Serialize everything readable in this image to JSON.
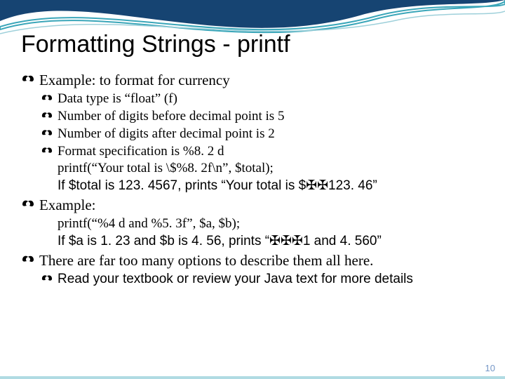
{
  "title": "Formatting Strings - printf",
  "lines": {
    "l1": "Example: to format for currency",
    "l2": "Data type is “float” (f)",
    "l3": "Number of digits before decimal point is 5",
    "l4": "Number of digits after decimal point is 2",
    "l5": "Format specification is %8. 2 d",
    "l6": "printf(“Your total is \\$%8. 2f\\n”, $total);",
    "l7": "If $total is 123. 4567,  prints “Your total is $✠✠123. 46”",
    "l8": "Example:",
    "l9": "printf(“%4 d and %5. 3f”, $a, $b);",
    "l10": "If $a is 1. 23 and $b is 4. 56, prints “✠✠✠1 and 4. 560”",
    "l11": "There are far too many options to describe them all here.",
    "l12": "Read your textbook or review your Java text for more details"
  },
  "page_number": "10"
}
